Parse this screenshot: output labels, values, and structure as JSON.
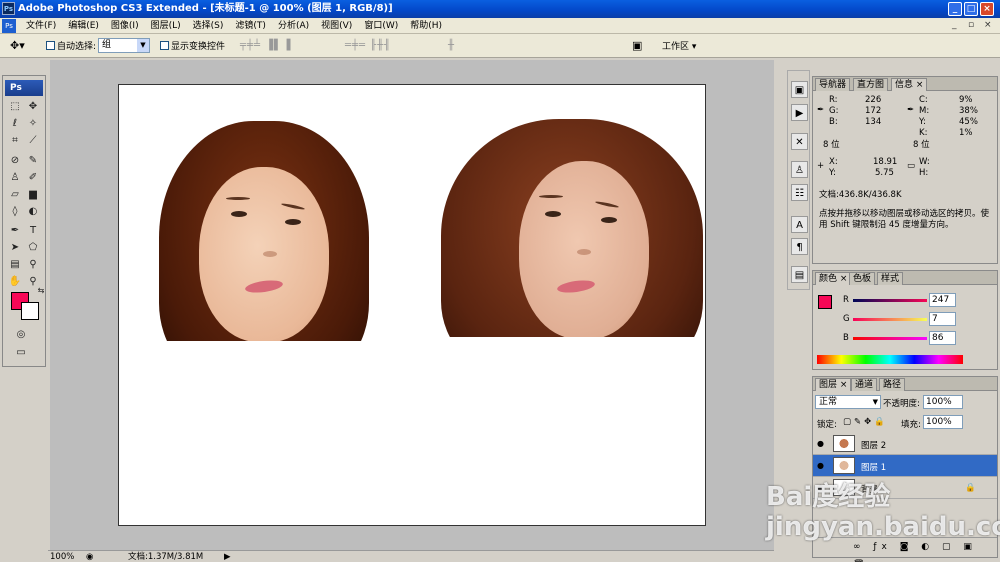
{
  "window": {
    "title": "Adobe Photoshop CS3 Extended - [未标题-1 @ 100% (图层 1, RGB/8)]",
    "app_icon": "Ps"
  },
  "menu": [
    "文件(F)",
    "编辑(E)",
    "图像(I)",
    "图层(L)",
    "选择(S)",
    "滤镜(T)",
    "分析(A)",
    "视图(V)",
    "窗口(W)",
    "帮助(H)"
  ],
  "options": {
    "auto_select_label": "自动选择:",
    "auto_select_value": "组",
    "show_transform_label": "显示变换控件",
    "workspace_label": "工作区 ▾"
  },
  "toolbox": {
    "logo": "Ps"
  },
  "info_panel": {
    "tabs": [
      "导航器",
      "直方图",
      "信息 ×"
    ],
    "r": "226",
    "g": "172",
    "b": "134",
    "c": "9%",
    "m": "38%",
    "y": "45%",
    "k": "1%",
    "bits_left": "8 位",
    "bits_right": "8 位",
    "x": "18.91",
    "yv": "5.75",
    "doc": "文档:436.8K/436.8K",
    "hint": "点按并拖移以移动图层或移动选区的拷贝。使用 Shift 键限制沿 45 度增量方向。"
  },
  "color_panel": {
    "tabs": [
      "颜色 ×",
      "色板",
      "样式"
    ],
    "r_label": "R",
    "g_label": "G",
    "b_label": "B",
    "r": "247",
    "g": "7",
    "b": "86",
    "fg_color": "#f70756"
  },
  "layers_panel": {
    "tabs": [
      "图层 ×",
      "通道",
      "路径"
    ],
    "blend": "正常",
    "opacity_label": "不透明度:",
    "opacity": "100%",
    "lock_label": "锁定:",
    "fill_label": "填充:",
    "fill": "100%",
    "layers": [
      "图层 2",
      "图层 1",
      "背景"
    ]
  },
  "status": {
    "zoom": "100%",
    "doc": "文档:1.37M/3.81M"
  },
  "watermark": "Bai度经验 jingyan.baidu.com"
}
